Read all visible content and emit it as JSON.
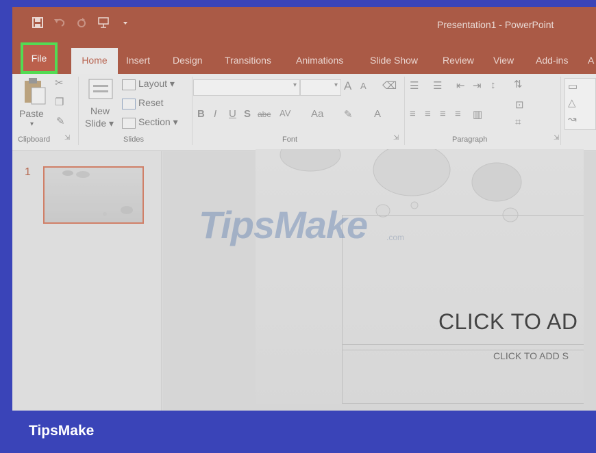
{
  "window": {
    "title": "Presentation1  -  PowerPoint"
  },
  "quick_access": [
    {
      "icon": "save-icon"
    },
    {
      "icon": "undo-icon"
    },
    {
      "icon": "redo-icon"
    },
    {
      "icon": "start-from-beginning-icon"
    },
    {
      "icon": "customize-qat-icon"
    }
  ],
  "tabs": {
    "file": "File",
    "home": "Home",
    "insert": "Insert",
    "design": "Design",
    "transitions": "Transitions",
    "animations": "Animations",
    "slide_show": "Slide Show",
    "review": "Review",
    "view": "View",
    "add_ins": "Add-ins",
    "more": "A"
  },
  "ribbon": {
    "clipboard": {
      "paste": "Paste",
      "group_label": "Clipboard"
    },
    "slides": {
      "new_slide_line1": "New",
      "new_slide_line2": "Slide ▾",
      "layout": "Layout ▾",
      "reset": "Reset",
      "section": "Section ▾",
      "group_label": "Slides"
    },
    "font": {
      "bold": "B",
      "italic": "I",
      "underline": "U",
      "strike": "S",
      "shadow": "abc",
      "spacing": "AV",
      "case": "Aa",
      "grow": "A",
      "shrink": "A",
      "color": "A",
      "group_label": "Font"
    },
    "paragraph": {
      "group_label": "Paragraph"
    }
  },
  "thumbnails": [
    {
      "number": "1"
    }
  ],
  "slide": {
    "title_placeholder": "CLICK TO AD",
    "subtitle_placeholder": "CLICK TO ADD S"
  },
  "watermark": {
    "text": "TipsMake",
    "suffix": ".com"
  },
  "footer": {
    "brand": "TipsMake"
  },
  "colors": {
    "accent": "#a23c22",
    "highlight": "#33e032",
    "frame": "#3a44b8"
  }
}
